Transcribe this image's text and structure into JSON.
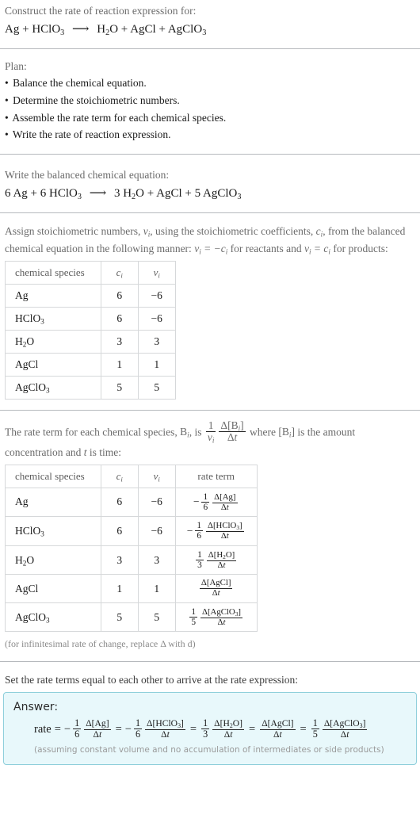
{
  "header": {
    "prompt": "Construct the rate of reaction expression for:",
    "equation": {
      "reactants": [
        "Ag",
        "HClO3"
      ],
      "products": [
        "H2O",
        "AgCl",
        "AgClO3"
      ],
      "display": "Ag + HClO3 ⟶ H2O + AgCl + AgClO3"
    }
  },
  "plan": {
    "title": "Plan:",
    "steps": [
      "Balance the chemical equation.",
      "Determine the stoichiometric numbers.",
      "Assemble the rate term for each chemical species.",
      "Write the rate of reaction expression."
    ]
  },
  "balanced": {
    "title": "Write the balanced chemical equation:",
    "display": "6 Ag + 6 HClO3 ⟶ 3 H2O + AgCl + 5 AgClO3",
    "reactant_coeffs": [
      "6",
      "6"
    ],
    "product_coeffs": [
      "3",
      "",
      "5"
    ]
  },
  "stoich": {
    "intro_1": "Assign stoichiometric numbers, ",
    "intro_2": ", using the stoichiometric coefficients, ",
    "intro_3": ", from the balanced chemical equation in the following manner: ",
    "intro_4": " for reactants and ",
    "intro_5": " for products:",
    "columns": [
      "chemical species",
      "c_i",
      "v_i"
    ],
    "col_species": "chemical species",
    "rows": [
      {
        "species": "Ag",
        "formula": [
          "Ag"
        ],
        "c": "6",
        "v": "−6"
      },
      {
        "species": "HClO3",
        "formula": [
          "HClO",
          "3"
        ],
        "c": "6",
        "v": "−6"
      },
      {
        "species": "H2O",
        "formula": [
          "H",
          "2",
          "O"
        ],
        "c": "3",
        "v": "3"
      },
      {
        "species": "AgCl",
        "formula": [
          "AgCl"
        ],
        "c": "1",
        "v": "1"
      },
      {
        "species": "AgClO3",
        "formula": [
          "AgClO",
          "3"
        ],
        "c": "5",
        "v": "5"
      }
    ]
  },
  "rateterm": {
    "intro_1": "The rate term for each chemical species, ",
    "intro_2": ", is ",
    "intro_3": " where ",
    "intro_4": " is the amount concentration and ",
    "intro_5": " is time:",
    "col_species": "chemical species",
    "col_rate": "rate term",
    "rows": [
      {
        "species": "Ag",
        "c": "6",
        "v": "−6",
        "sign": "−",
        "coef_num": "1",
        "coef_den": "6",
        "delta_species": "Δ[Ag]",
        "delta_t": "Δt"
      },
      {
        "species": "HClO3",
        "c": "6",
        "v": "−6",
        "sign": "−",
        "coef_num": "1",
        "coef_den": "6",
        "delta_species": "Δ[HClO3]",
        "delta_t": "Δt"
      },
      {
        "species": "H2O",
        "c": "3",
        "v": "3",
        "sign": "",
        "coef_num": "1",
        "coef_den": "3",
        "delta_species": "Δ[H2O]",
        "delta_t": "Δt"
      },
      {
        "species": "AgCl",
        "c": "1",
        "v": "1",
        "sign": "",
        "coef_num": "",
        "coef_den": "",
        "delta_species": "Δ[AgCl]",
        "delta_t": "Δt"
      },
      {
        "species": "AgClO3",
        "c": "5",
        "v": "5",
        "sign": "",
        "coef_num": "1",
        "coef_den": "5",
        "delta_species": "Δ[AgClO3]",
        "delta_t": "Δt"
      }
    ],
    "footnote": "(for infinitesimal rate of change, replace Δ with d)"
  },
  "final": {
    "intro": "Set the rate terms equal to each other to arrive at the rate expression:",
    "answer_label": "Answer:",
    "rate_word": "rate",
    "expression": "rate = − 1/6 Δ[Ag]/Δt = − 1/6 Δ[HClO3]/Δt = 1/3 Δ[H2O]/Δt = Δ[AgCl]/Δt = 1/5 Δ[AgClO3]/Δt",
    "note": "(assuming constant volume and no accumulation of intermediates or side products)"
  },
  "colors": {
    "answer_border": "#8ecfdb",
    "answer_background": "#e8f8fb",
    "divider": "#b6b9bd",
    "table_border": "#d6d8da",
    "muted_text": "#6b6b6b"
  }
}
